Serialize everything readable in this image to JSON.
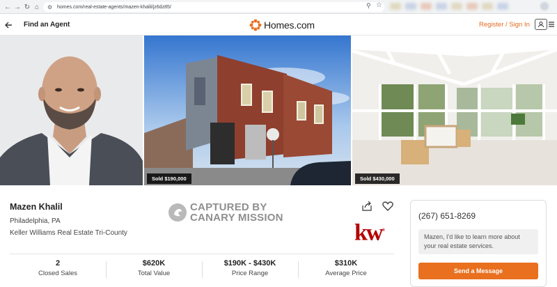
{
  "browser": {
    "url": "homes.com/real-estate-agents/mazen-khalil/jz6dz85/"
  },
  "header": {
    "title": "Find an Agent",
    "logo_text": "Homes.com",
    "register_label": "Register / Sign In"
  },
  "photos": [
    {
      "name": "agent-photo",
      "badge": ""
    },
    {
      "name": "house-photo",
      "badge": "Sold $190,000"
    },
    {
      "name": "sunroom-photo",
      "badge": "Sold $430,000"
    }
  ],
  "agent": {
    "name": "Mazen Khalil",
    "location": "Philadelphia, PA",
    "company": "Keller Williams Real Estate Tri-County",
    "brokerage_logo": "kw"
  },
  "watermark": {
    "line1": "CAPTURED BY",
    "line2": "CANARY MISSION"
  },
  "stats": [
    {
      "value": "2",
      "label": "Closed Sales"
    },
    {
      "value": "$620K",
      "label": "Total Value"
    },
    {
      "value": "$190K - $430K",
      "label": "Price Range"
    },
    {
      "value": "$310K",
      "label": "Average Price"
    }
  ],
  "contact": {
    "phone": "(267) 651-8269",
    "message": "Mazen, I'd like to learn more about your real estate services.",
    "send_label": "Send a Message"
  },
  "colors": {
    "accent": "#e9701f",
    "kw_red": "#b40101"
  }
}
